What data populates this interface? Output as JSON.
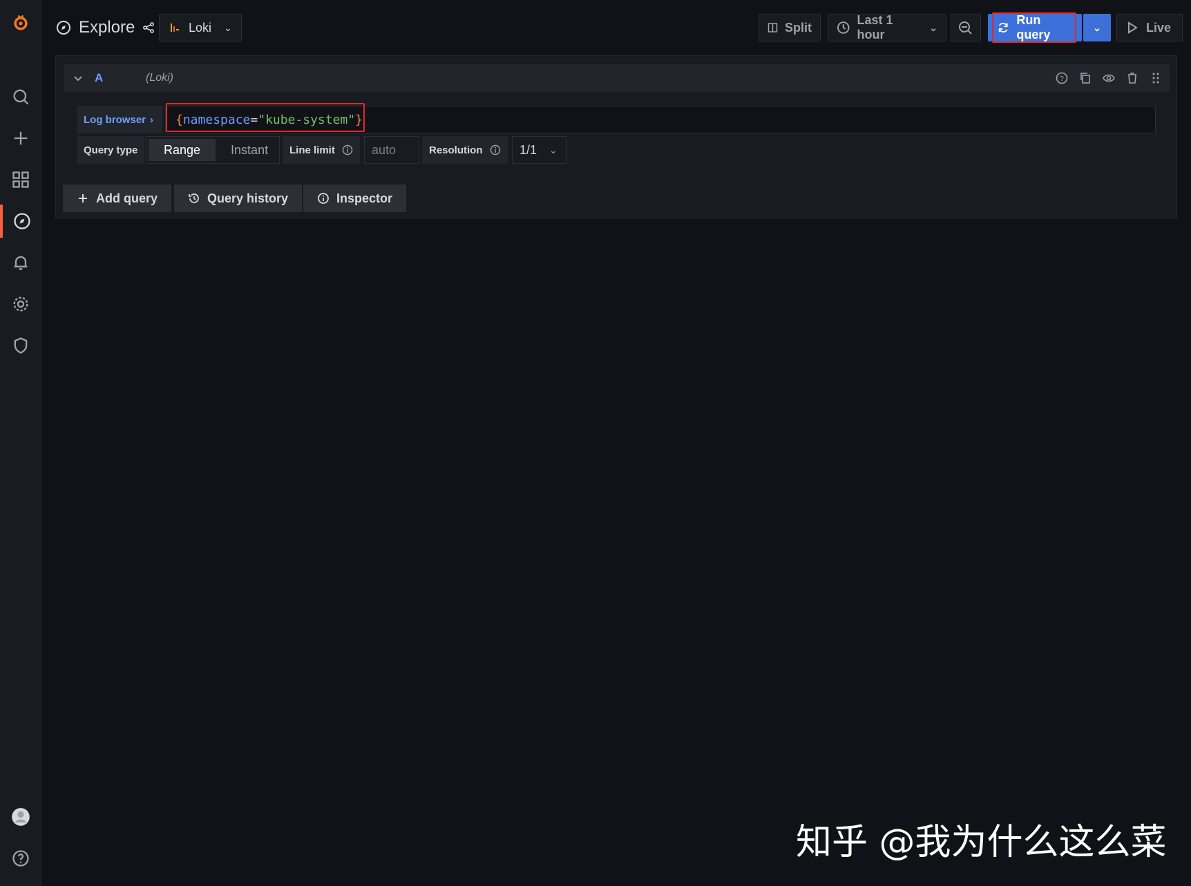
{
  "header": {
    "title": "Explore",
    "datasource": "Loki",
    "split_label": "Split",
    "time_range": "Last 1 hour",
    "run_label": "Run query",
    "live_label": "Live"
  },
  "query": {
    "letter": "A",
    "datasource_label": "(Loki)",
    "log_browser_label": "Log browser",
    "tokens": {
      "open": "{",
      "key": "namespace",
      "eq": "=",
      "value": "\"kube-system\"",
      "close": "}"
    },
    "options": {
      "query_type_label": "Query type",
      "range_label": "Range",
      "instant_label": "Instant",
      "line_limit_label": "Line limit",
      "line_limit_placeholder": "auto",
      "resolution_label": "Resolution",
      "resolution_value": "1/1"
    }
  },
  "actions": {
    "add_query": "Add query",
    "query_history": "Query history",
    "inspector": "Inspector"
  },
  "watermark": "知乎 @我为什么这么菜",
  "colors": {
    "background": "#111217",
    "accent": "#3d71d9",
    "active_nav": "#f55f3e",
    "highlight_box": "#e02a2a"
  }
}
